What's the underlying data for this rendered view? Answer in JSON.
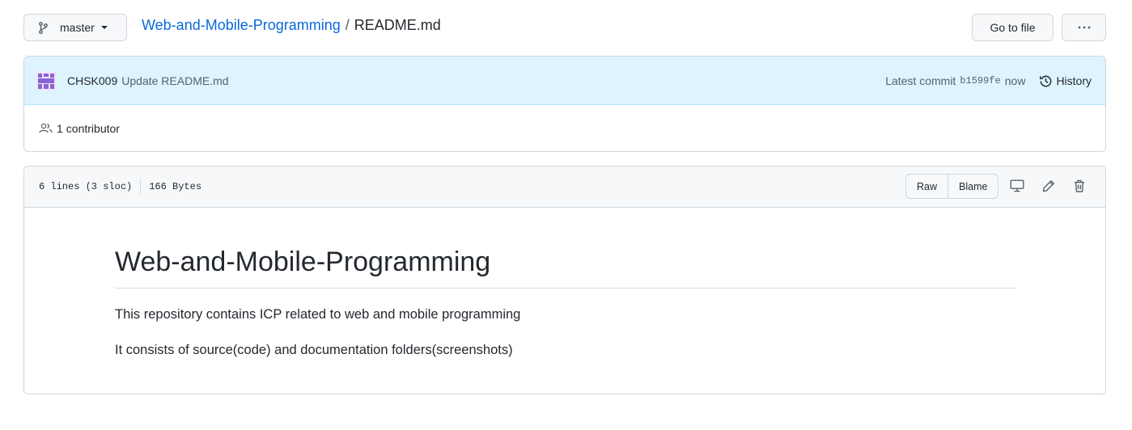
{
  "branch": {
    "label": "master"
  },
  "breadcrumb": {
    "repo": "Web-and-Mobile-Programming",
    "separator": "/",
    "file": "README.md"
  },
  "actions": {
    "goto_file": "Go to file",
    "more": "···"
  },
  "commit": {
    "author": "CHSK009",
    "message": "Update README.md",
    "latest_label": "Latest commit",
    "sha": "b1599fe",
    "time": "now",
    "history_label": "History"
  },
  "contributors": {
    "count": "1",
    "label": "contributor"
  },
  "file": {
    "lines": "6 lines (3 sloc)",
    "size": "166 Bytes",
    "raw_label": "Raw",
    "blame_label": "Blame"
  },
  "readme": {
    "heading": "Web-and-Mobile-Programming",
    "paragraphs": [
      "This repository contains ICP related to web and mobile programming",
      "It consists of source(code) and documentation folders(screenshots)"
    ]
  },
  "colors": {
    "link": "#0969da",
    "commit_bg": "#ddf4ff",
    "border": "#d0d7de",
    "avatar": "#8a63d2"
  }
}
